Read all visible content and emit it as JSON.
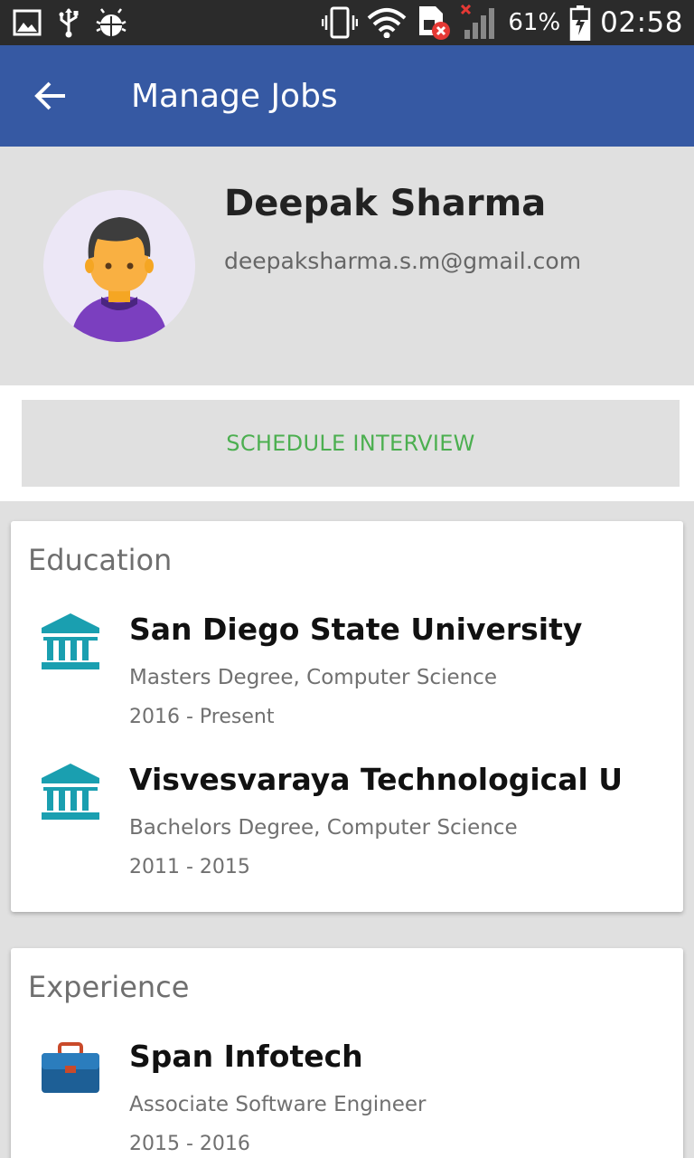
{
  "status_bar": {
    "battery_percent": "61%",
    "time": "02:58",
    "icons": [
      "image-icon",
      "usb-icon",
      "android-debug-icon",
      "vibrate-icon",
      "wifi-icon",
      "sim-error-icon",
      "signal-icon",
      "battery-charging-icon"
    ]
  },
  "app_bar": {
    "title": "Manage Jobs",
    "back_icon": "arrow-back-icon",
    "color": "#3659a3"
  },
  "profile": {
    "name": "Deepak Sharma",
    "email": "deepaksharma.s.m@gmail.com",
    "avatar_icon": "person-avatar-icon"
  },
  "actions": {
    "schedule_label": "SCHEDULE INTERVIEW",
    "accent_color": "#4caf50"
  },
  "education": {
    "title": "Education",
    "items": [
      {
        "school": "San Diego State University",
        "degree": "Masters Degree, Computer Science",
        "dates": "2016 - Present",
        "icon": "institution-icon"
      },
      {
        "school": "Visvesvaraya Technological U",
        "degree": "Bachelors Degree, Computer Science",
        "dates": "2011 - 2015",
        "icon": "institution-icon"
      }
    ]
  },
  "experience": {
    "title": "Experience",
    "items": [
      {
        "company": "Span Infotech",
        "role": "Associate Software Engineer",
        "dates": "2015 - 2016",
        "icon": "briefcase-icon"
      }
    ]
  }
}
